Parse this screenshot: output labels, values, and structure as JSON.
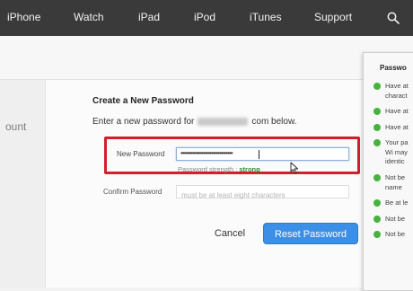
{
  "nav": {
    "items": [
      "iPhone",
      "Watch",
      "iPad",
      "iPod",
      "iTunes",
      "Support"
    ],
    "search_icon": "search-icon"
  },
  "left": {
    "account_text": "ount"
  },
  "form": {
    "title": "Create a New Password",
    "instruction_prefix": "Enter a new password for",
    "instruction_suffix": "com below.",
    "new_password_label": "New Password",
    "new_password_value": "••••••••••••••••••••••••••••••••",
    "strength_label": "Password strength :",
    "strength_value": "strong",
    "confirm_label": "Confirm Password",
    "confirm_placeholder": "must be at least eight characters",
    "cancel_label": "Cancel",
    "reset_label": "Reset Password"
  },
  "requirements": {
    "title": "Passwo",
    "items": [
      {
        "text": "Have at",
        "text2": "charact"
      },
      {
        "text": "Have at"
      },
      {
        "text": "Have at"
      },
      {
        "text": "Your pa",
        "text2": "Wi may",
        "text3": "identic"
      },
      {
        "text": "Not be",
        "text2": "name"
      },
      {
        "text": "Be at le"
      },
      {
        "text": "Not be"
      },
      {
        "text": "Not be"
      }
    ]
  },
  "colors": {
    "nav_bg": "#3a3a3a",
    "highlight_border": "#d21f2e",
    "primary_button": "#3c8fe6",
    "status_ok": "#45b33e",
    "strength_ok": "#2f8a2f"
  }
}
